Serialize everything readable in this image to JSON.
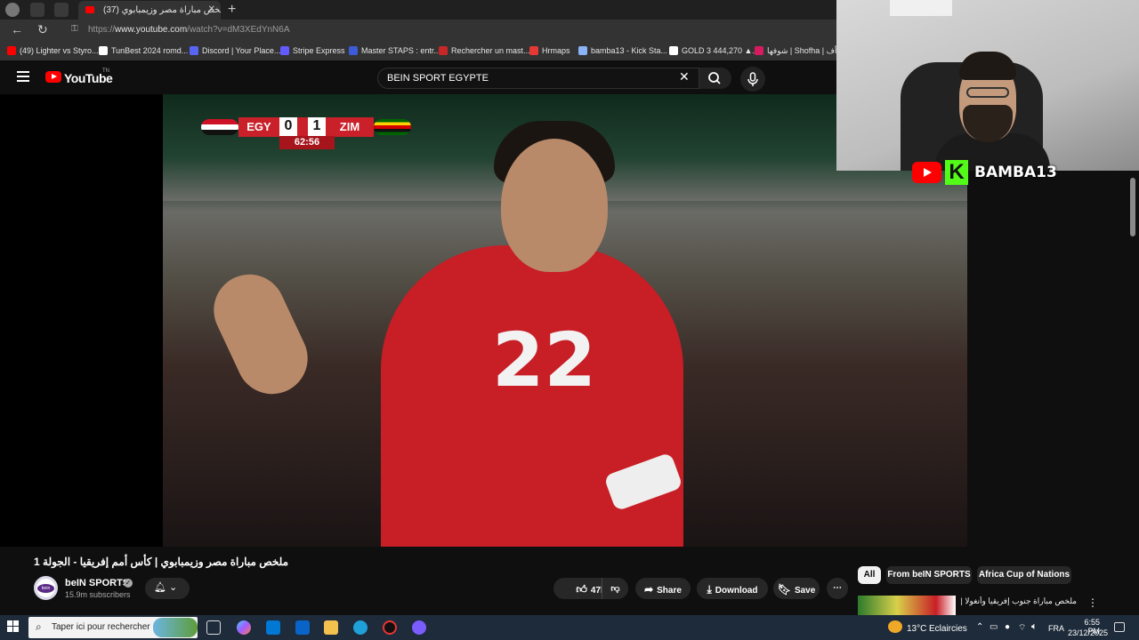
{
  "browser": {
    "tab_title": "ملخص مباراة مصر وزيمبابوي (37)",
    "new_tab": "+",
    "url_prefix": "https://",
    "url_host": "www.youtube.com",
    "url_path": "/watch?v=dM3XEdYnN6A",
    "bookmarks": [
      {
        "label": "(49) Lighter vs Styro...",
        "color": "#ff0000"
      },
      {
        "label": "TunBest 2024 romd...",
        "color": "#ffffff"
      },
      {
        "label": "Discord | Your Place...",
        "color": "#5865f2"
      },
      {
        "label": "Stripe Express",
        "color": "#635bff"
      },
      {
        "label": "Master STAPS : entr...",
        "color": "#3c5bd6"
      },
      {
        "label": "Rechercher un mast...",
        "color": "#c62828"
      },
      {
        "label": "Hrmaps",
        "color": "#e53935"
      },
      {
        "label": "bamba13 - Kick Sta...",
        "color": "#8ab4f8"
      },
      {
        "label": "GOLD 3 444,270 ▲...",
        "color": "#ffffff"
      },
      {
        "label": "شوفها | Shofha | أف...",
        "color": "#d81b60"
      }
    ]
  },
  "youtube": {
    "logo_text": "YouTube",
    "country_code": "TN",
    "search_value": "BEIN SPORT EGYPTE",
    "video_title": "ملخص مباراة مصر وزيمبابوي | كأس أمم إفريقيا - الجولة 1",
    "channel_name": "beIN SPORTS",
    "subscribers": "15.9m subscribers",
    "likes": "47k",
    "share_label": "Share",
    "download_label": "Download",
    "save_label": "Save",
    "chips": [
      "All",
      "From beIN SPORTS",
      "Africa Cup of Nations"
    ],
    "rec_title": "ملخص مباراة جنوب إفريقيا وأنغولا | كأس"
  },
  "scoreboard": {
    "home": "EGY",
    "home_score": "0",
    "away": "ZIM",
    "away_score": "1",
    "clock": "62:56"
  },
  "player_number": "22",
  "streamer": {
    "name": "BAMBA13",
    "platform_letter": "K"
  },
  "taskbar": {
    "search_placeholder": "Taper ici pour rechercher",
    "temperature": "13°C",
    "weather": "Eclaircies",
    "language": "FRA",
    "time": "6:55 PM",
    "date": "23/12/2025"
  }
}
